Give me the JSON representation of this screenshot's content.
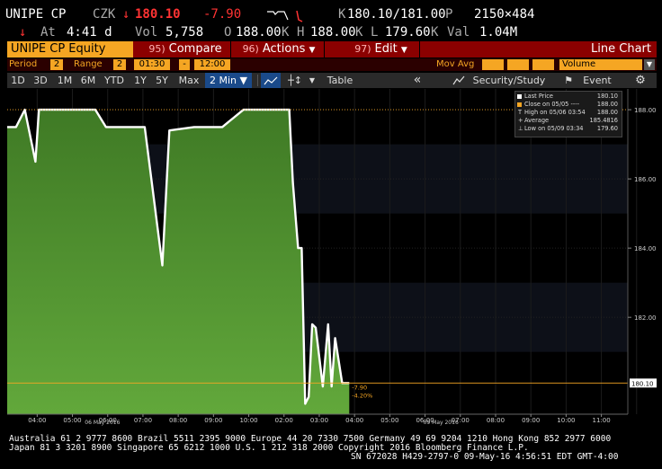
{
  "quote": {
    "ticker": "UNIPE CP",
    "currency": "CZK",
    "arrow": "↓",
    "price": "180.10",
    "change": "-7.90",
    "bid_label": "K",
    "bid_ask": "180.10/181.00",
    "ask_label": "P",
    "size": "2150×484",
    "at_label": "At",
    "time": "4:41 d",
    "vol_label": "Vol",
    "volume": "5,758",
    "open_label": "O",
    "open": "188.00",
    "open_unit": "K",
    "high_label": "H",
    "high": "188.00",
    "high_unit": "K",
    "low_label": "L",
    "low": "179.60",
    "low_unit": "K",
    "val_label": "Val",
    "value": "1.04M"
  },
  "command_bar": {
    "security": "UNIPE CP Equity",
    "compare_num": "95)",
    "compare": "Compare",
    "actions_num": "96)",
    "actions": "Actions",
    "edit_num": "97)",
    "edit": "Edit",
    "view": "Line Chart"
  },
  "period_row": {
    "period_label": "Period",
    "period_value": "2",
    "range_label": "Range",
    "range_value": "2",
    "start_time": "01:30",
    "dash": "-",
    "end_time": "12:00",
    "mov_avg_label": "Mov Avg",
    "study_value": "Volume"
  },
  "toolbar": {
    "buttons": [
      "1D",
      "3D",
      "1M",
      "6M",
      "YTD",
      "1Y",
      "5Y",
      "Max"
    ],
    "interval": "2 Min ▼",
    "table": "Table",
    "back": "«",
    "security_study": "Security/Study",
    "event": "Event"
  },
  "legend": {
    "last_price_label": "Last Price",
    "last_price": "180.10",
    "close_label": "Close on 05/05 ----",
    "close": "188.00",
    "high_label": "High on 05/06 03:54",
    "high": "188.00",
    "average_label": "Average",
    "average": "185.4816",
    "low_label": "Low on 05/09 03:34",
    "low": "179.60"
  },
  "annotations": {
    "last_tag": "180.10",
    "change": "-7.90",
    "change_pct": "-4.20%"
  },
  "chart_data": {
    "type": "area",
    "title": "",
    "xlabel": "",
    "ylabel": "",
    "ylim": [
      179.2,
      188.6
    ],
    "y_ticks": [
      "188.00",
      "186.00",
      "184.00",
      "182.00"
    ],
    "x_ticks": [
      "04:00",
      "05:00",
      "06:00",
      "07:00",
      "08:00",
      "09:00",
      "10:00",
      "02:00",
      "03:00",
      "04:00",
      "05:00",
      "06:00",
      "07:00",
      "08:00",
      "09:00",
      "10:00",
      "11:00"
    ],
    "date_labels": [
      "06 May 2016",
      "09 May 2016"
    ],
    "series": [
      {
        "name": "Last Price",
        "x": [
          0,
          0.25,
          0.5,
          0.8,
          0.9,
          1.1,
          1.5,
          2.5,
          2.8,
          3.0,
          3.9,
          4.4,
          4.6,
          5.3,
          5.7,
          6.1,
          6.7,
          7.2,
          7.6,
          8.0,
          8.1,
          8.25,
          8.35,
          8.45,
          8.55,
          8.65,
          8.75,
          8.95,
          9.1,
          9.2,
          9.3,
          9.5,
          9.7
        ],
        "values": [
          187.5,
          187.5,
          188.0,
          186.5,
          188.0,
          188.0,
          188.0,
          188.0,
          187.5,
          187.5,
          187.5,
          183.5,
          187.4,
          187.5,
          187.5,
          187.5,
          188.0,
          188.0,
          188.0,
          188.0,
          185.9,
          184.0,
          184.0,
          179.5,
          179.7,
          181.8,
          181.7,
          180.0,
          181.8,
          180.0,
          181.4,
          180.1,
          180.1
        ]
      }
    ],
    "x_range": [
      0,
      17.6
    ],
    "reference_lines": [
      {
        "name": "Close on 05/05",
        "value": 188.0,
        "color": "#f5a623",
        "style": "dotted"
      },
      {
        "name": "Last Price",
        "value": 180.1,
        "color": "#f5a623",
        "style": "solid"
      }
    ],
    "colors": {
      "fill": "#3d8b1f",
      "line": "#ffffff",
      "accent": "#f5a623"
    },
    "grid": true,
    "legend_position": "top-right"
  },
  "footer": {
    "line1": "Australia 61 2 9777 8600 Brazil 5511 2395 9000 Europe 44 20 7330 7500 Germany 49 69 9204 1210 Hong Kong 852 2977 6000",
    "line2": "Japan 81 3 3201 8900       Singapore 65 6212 1000       U.S. 1 212 318 2000          Copyright 2016 Bloomberg Finance L.P.",
    "line3": "SN 672028 H429-2797-0 09-May-16  4:56:51 EDT  GMT-4:00"
  }
}
